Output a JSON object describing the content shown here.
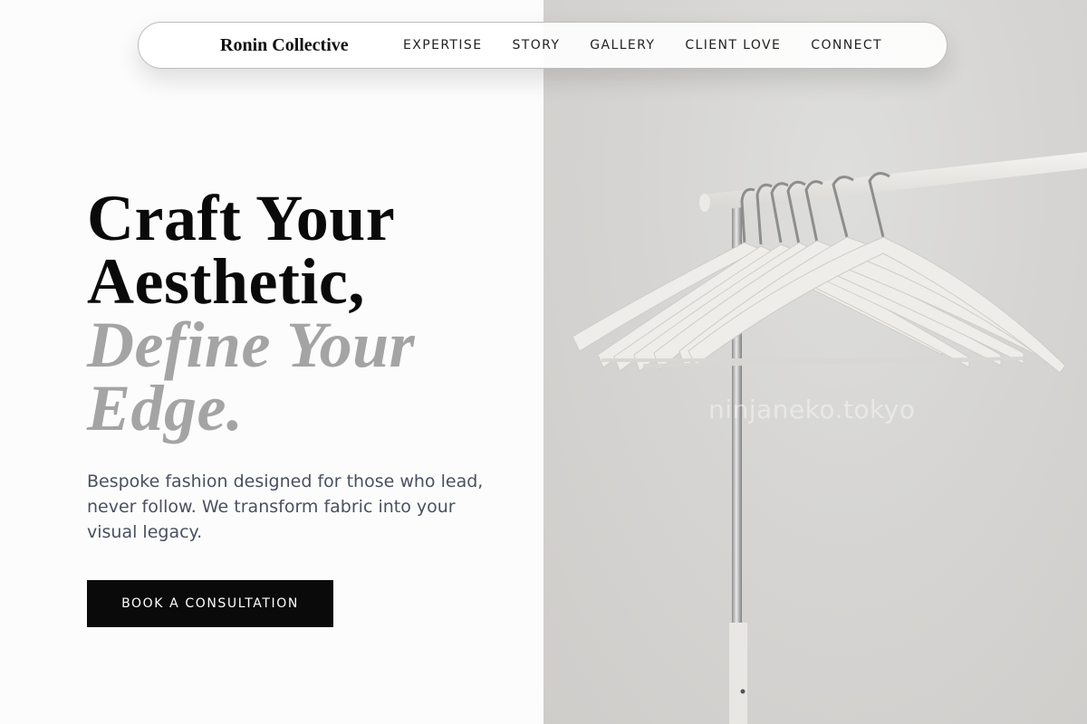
{
  "brand": {
    "name": "Ronin Collective"
  },
  "nav": {
    "items": [
      {
        "label": "EXPERTISE"
      },
      {
        "label": "STORY"
      },
      {
        "label": "GALLERY"
      },
      {
        "label": "CLIENT LOVE"
      },
      {
        "label": "CONNECT"
      }
    ]
  },
  "hero": {
    "headline_line1": "Craft Your",
    "headline_line2": "Aesthetic,",
    "headline_line3": "Define Your",
    "headline_line4": "Edge.",
    "description": "Bespoke fashion designed for those who lead, never follow. We transform fabric into your visual legacy.",
    "cta_label": "BOOK A CONSULTATION"
  },
  "image": {
    "watermark": "ninjaneko.tokyo",
    "subject_icon": "clothes-rack-with-hangers"
  },
  "colors": {
    "accent_dark": "#0a0a0a",
    "headline_muted": "#a4a4a4",
    "body_text": "#4a5060",
    "photo_bg": "#d6d5d3"
  }
}
